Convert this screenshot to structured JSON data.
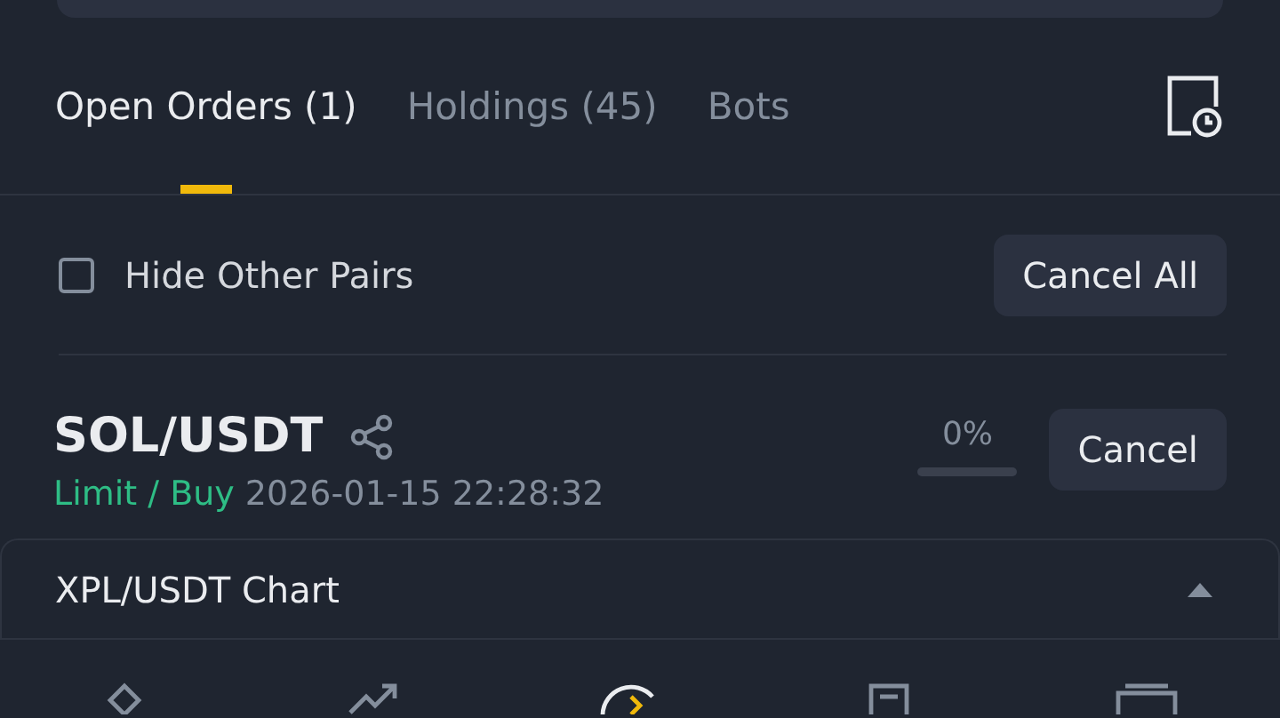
{
  "tabs": [
    {
      "label": "Open Orders (1)",
      "selected": true
    },
    {
      "label": "Holdings (45)",
      "selected": false
    },
    {
      "label": "Bots",
      "selected": false
    }
  ],
  "filter": {
    "label": "Hide Other Pairs",
    "checked": false
  },
  "cancel_all": "Cancel All",
  "orders": [
    {
      "pair": "SOL/USDT",
      "side": "Limit / Buy",
      "time": "2026-01-15 22:28:32",
      "filled": "0%",
      "level": 0,
      "action": "Cancel"
    }
  ],
  "chart_bar": {
    "title": "XPL/USDT Chart",
    "expanded": false
  }
}
